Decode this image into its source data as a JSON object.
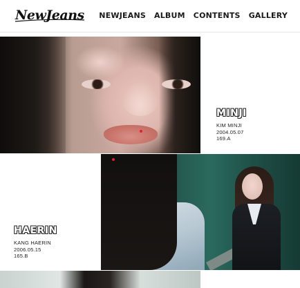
{
  "header": {
    "logo": "NewJeans",
    "nav": [
      "NEWJEANS",
      "ALBUM",
      "CONTENTS",
      "GALLERY"
    ]
  },
  "members": [
    {
      "name": "MINJI",
      "full_name": "KIM MINJI",
      "birth": "2004.05.07",
      "height": "169.A"
    },
    {
      "name": "HAERIN",
      "full_name": "KANG HAERIN",
      "birth": "2006.05.15",
      "height": "165.B"
    }
  ],
  "colors": {
    "accent_dot": "#e0202a"
  }
}
